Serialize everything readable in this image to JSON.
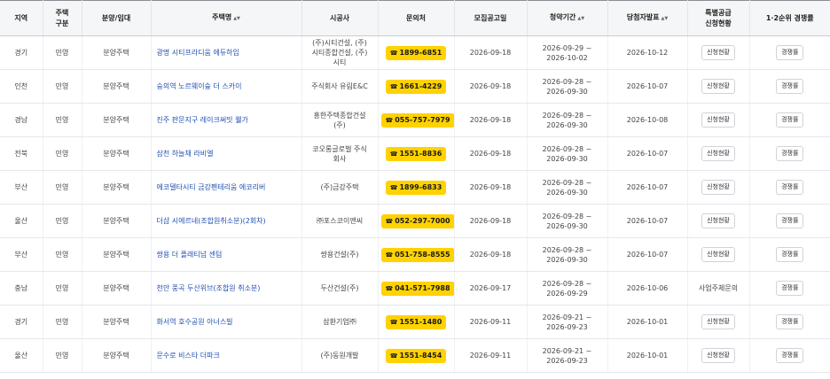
{
  "headers": {
    "region": "지역",
    "type": "주택\n구분",
    "sale": "분양/임대",
    "name": "주택명",
    "builder": "시공사",
    "contact": "문의처",
    "notice": "모집공고일",
    "period": "청약기간",
    "winner": "당첨자발표",
    "special": "특별공급\n신청현황",
    "compete": "1·2순위 경쟁률"
  },
  "sort_glyph": "▲▼",
  "phone_icon": "phone-icon",
  "rows": [
    {
      "region": "경기",
      "type": "민영",
      "sale": "분양주택",
      "name": "광명 시티프라디움 에듀하임",
      "builder": "(주)시티건설, (주)\n시티종합건설, (주)\n시티",
      "phone": "1899-6851",
      "notice": "2026-09-18",
      "period_start": "2026-09-29 ~",
      "period_end": "2026-10-02",
      "winner": "2026-10-12",
      "special": "신청현황",
      "compete": "경쟁률"
    },
    {
      "region": "인천",
      "type": "민영",
      "sale": "분양주택",
      "name": "숭의역 노르웨이숲 더 스카이",
      "builder": "주식회사 유림E&C",
      "phone": "1661-4229",
      "notice": "2026-09-18",
      "period_start": "2026-09-28 ~",
      "period_end": "2026-09-30",
      "winner": "2026-10-07",
      "special": "신청현황",
      "compete": "경쟁률"
    },
    {
      "region": "경남",
      "type": "민영",
      "sale": "분양주택",
      "name": "진주 판문지구 레이크써밋 웰가",
      "builder": "흥한주택종합건설\n(주)",
      "phone": "055-757-7979",
      "notice": "2026-09-18",
      "period_start": "2026-09-28 ~",
      "period_end": "2026-09-30",
      "winner": "2026-10-08",
      "special": "신청현황",
      "compete": "경쟁률"
    },
    {
      "region": "전북",
      "type": "민영",
      "sale": "분양주택",
      "name": "삼천 하늘채 라비엘",
      "builder": "코오롱글로벌 주식\n회사",
      "phone": "1551-8836",
      "notice": "2026-09-18",
      "period_start": "2026-09-28 ~",
      "period_end": "2026-09-30",
      "winner": "2026-10-07",
      "special": "신청현황",
      "compete": "경쟁률"
    },
    {
      "region": "부산",
      "type": "민영",
      "sale": "분양주택",
      "name": "에코델타시티 금강펜테리움 에코리버",
      "builder": "(주)금강주택",
      "phone": "1899-6833",
      "notice": "2026-09-18",
      "period_start": "2026-09-28 ~",
      "period_end": "2026-09-30",
      "winner": "2026-10-07",
      "special": "신청현황",
      "compete": "경쟁률"
    },
    {
      "region": "울산",
      "type": "민영",
      "sale": "분양주택",
      "name": "더샵 시에르네(조합원취소분)(2회차)",
      "builder": "㈜포스코이앤씨",
      "phone": "052-297-7000",
      "notice": "2026-09-18",
      "period_start": "2026-09-28 ~",
      "period_end": "2026-09-30",
      "winner": "2026-10-07",
      "special": "신청현황",
      "compete": "경쟁률"
    },
    {
      "region": "부산",
      "type": "민영",
      "sale": "분양주택",
      "name": "쌍용 더 플래티넘 센텀",
      "builder": "쌍용건설(주)",
      "phone": "051-758-8555",
      "notice": "2026-09-18",
      "period_start": "2026-09-28 ~",
      "period_end": "2026-09-30",
      "winner": "2026-10-07",
      "special": "신청현황",
      "compete": "경쟁률"
    },
    {
      "region": "충남",
      "type": "민영",
      "sale": "분양주택",
      "name": "천안 풍곡 두산위브(조합원 취소분)",
      "builder": "두산건설(주)",
      "phone": "041-571-7988",
      "notice": "2026-09-17",
      "period_start": "2026-09-28 ~",
      "period_end": "2026-09-29",
      "winner": "2026-10-06",
      "special_text": "사업주체문의",
      "compete": "경쟁률"
    },
    {
      "region": "경기",
      "type": "민영",
      "sale": "분양주택",
      "name": "화서역 호수공원 아너스빌",
      "builder": "삼환기업㈜",
      "phone": "1551-1480",
      "notice": "2026-09-11",
      "period_start": "2026-09-21 ~",
      "period_end": "2026-09-23",
      "winner": "2026-10-01",
      "special": "신청현황",
      "compete": "경쟁률"
    },
    {
      "region": "울산",
      "type": "민영",
      "sale": "분양주택",
      "name": "문수로 비스타 더파크",
      "builder": "(주)동원개발",
      "phone": "1551-8454",
      "notice": "2026-09-11",
      "period_start": "2026-09-21 ~",
      "period_end": "2026-09-23",
      "winner": "2026-10-01",
      "special": "신청현황",
      "compete": "경쟁률"
    }
  ]
}
